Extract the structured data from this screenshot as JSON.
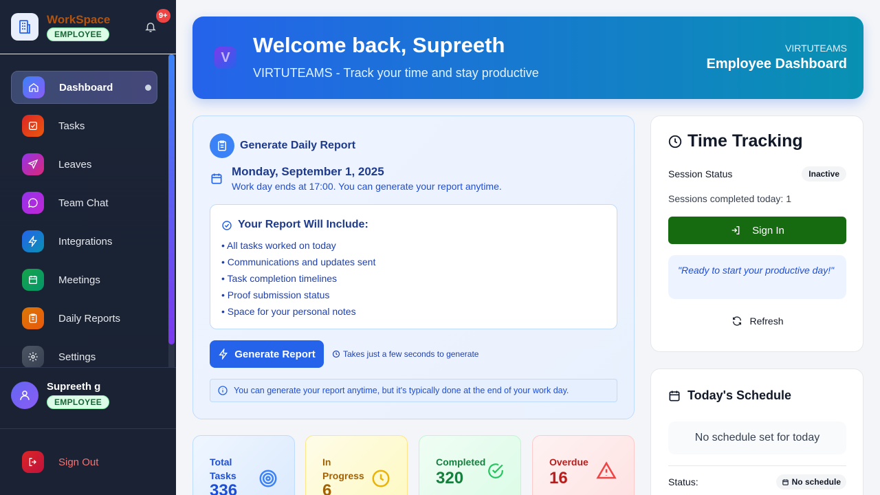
{
  "brand": {
    "name": "WorkSpace",
    "role_badge": "EMPLOYEE",
    "notification_count": "9+"
  },
  "sidebar": {
    "items": [
      {
        "label": "Dashboard",
        "icon": "home-icon",
        "active": true
      },
      {
        "label": "Tasks",
        "icon": "checkbox-icon"
      },
      {
        "label": "Leaves",
        "icon": "plane-icon"
      },
      {
        "label": "Team Chat",
        "icon": "chat-icon"
      },
      {
        "label": "Integrations",
        "icon": "bolt-icon"
      },
      {
        "label": "Meetings",
        "icon": "calendar-icon"
      },
      {
        "label": "Daily Reports",
        "icon": "clipboard-icon"
      },
      {
        "label": "Settings",
        "icon": "gear-icon"
      }
    ],
    "user": {
      "name": "Supreeth g",
      "role_badge": "EMPLOYEE"
    },
    "sign_out": "Sign Out"
  },
  "hero": {
    "title": "Welcome back, Supreeth",
    "subtitle": "VIRTUTEAMS - Track your time and stay productive",
    "org": "VIRTUTEAMS",
    "dashboard_label": "Employee Dashboard",
    "logo_letter": "V"
  },
  "report": {
    "title": "Generate Daily Report",
    "date": "Monday, September 1, 2025",
    "note": "Work day ends at 17:00. You can generate your report anytime.",
    "include_title": "Your Report Will Include:",
    "include_items": [
      "• All tasks worked on today",
      "• Communications and updates sent",
      "• Task completion timelines",
      "• Proof submission status",
      "• Space for your personal notes"
    ],
    "button": "Generate Report",
    "hint": "Takes just a few seconds to generate",
    "info": "You can generate your report anytime, but it's typically done at the end of your work day."
  },
  "stats": [
    {
      "label": "Total Tasks",
      "value": "336"
    },
    {
      "label": "In Progress",
      "value": "6"
    },
    {
      "label": "Completed",
      "value": "320"
    },
    {
      "label": "Overdue",
      "value": "16"
    }
  ],
  "time_tracking": {
    "title": "Time Tracking",
    "status_label": "Session Status",
    "status": "Inactive",
    "sessions": "Sessions completed today: 1",
    "sign_in": "Sign In",
    "quote": "\"Ready to start your productive day!\"",
    "refresh": "Refresh"
  },
  "schedule": {
    "title": "Today's Schedule",
    "empty": "No schedule set for today",
    "status_label": "Status:",
    "status": "No schedule"
  },
  "colors": {
    "primary": "#2563eb",
    "sign_in": "#166a10",
    "sidebar": "#1b2436"
  }
}
